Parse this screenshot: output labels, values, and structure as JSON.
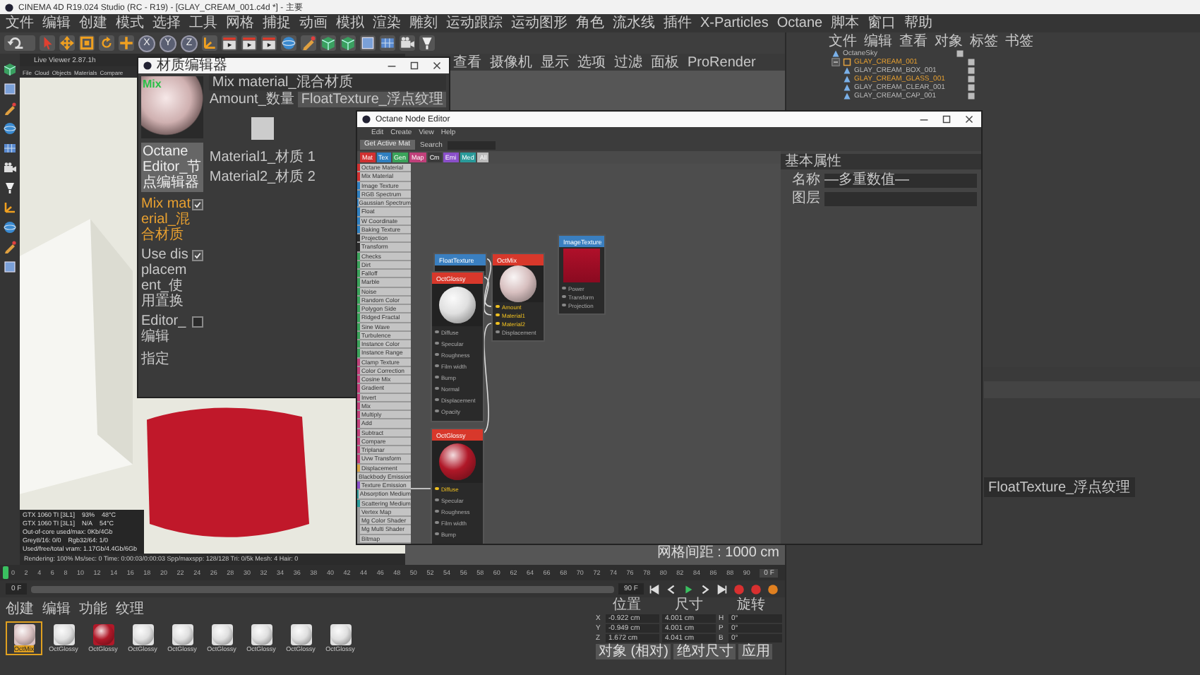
{
  "app": {
    "title": "CINEMA 4D R19.024 Studio (RC - R19) - [GLAY_CREAM_001.c4d *] - 主要",
    "menu": [
      "文件",
      "编辑",
      "创建",
      "模式",
      "选择",
      "工具",
      "网格",
      "捕捉",
      "动画",
      "模拟",
      "渲染",
      "雕刻",
      "运动跟踪",
      "运动图形",
      "角色",
      "流水线",
      "插件",
      "X-Particles",
      "Octane",
      "脚本",
      "窗口",
      "帮助"
    ],
    "axis_buttons": [
      "X",
      "Y",
      "Z"
    ]
  },
  "live_viewer": {
    "title": "Live Viewer 2.87.1h",
    "menu": [
      "File",
      "Cloud",
      "Objects",
      "Materials",
      "Compare"
    ],
    "stats": [
      [
        "GTX 1060 TI [3L1]",
        "93%",
        "48°C"
      ],
      [
        "GTX 1060 TI [3L1]",
        "N/A",
        "54°C"
      ],
      [
        "Out-of-core used/max: 0Kb/4Gb"
      ],
      [
        "Grey8/16: 0/0",
        "Rgb32/64: 1/0"
      ],
      [
        "Used/free/total vram: 1.17Gb/4.4Gb/6Gb"
      ]
    ],
    "status": "Rendering: 100%  Ms/sec: 0  Time: 0:00:03/0:00:03  Spp/maxspp: 128/128  Tri: 0/5k  Mesh: 4  Hair: 0"
  },
  "viewport": {
    "tabs": [
      "查看",
      "摄像机",
      "显示",
      "选项",
      "过滤",
      "面板",
      "ProRender"
    ],
    "grid_info": "网格间距 : 1000 cm"
  },
  "material_editor": {
    "title": "材质编辑器",
    "preview_label": "Mix",
    "heading": "Mix material_混合材质",
    "amount_label": "Amount_数量",
    "amount_texture": "FloatTexture_浮点纹理",
    "channels": [
      {
        "kind": "button",
        "label": "Octane Editor_节点编辑器"
      },
      {
        "kind": "check",
        "label": "Mix material_混合材质",
        "checked": true,
        "selected": true
      },
      {
        "kind": "check",
        "label": "Use displacement_使用置换",
        "checked": true,
        "selected": false
      },
      {
        "kind": "check",
        "label": "Editor_编辑",
        "checked": false,
        "selected": false
      },
      {
        "kind": "plain",
        "label": "指定"
      }
    ],
    "material_slots": [
      "Material1_材质 1",
      "Material2_材质 2"
    ]
  },
  "node_editor": {
    "title": "Octane Node Editor",
    "menu": [
      "Edit",
      "Create",
      "View",
      "Help"
    ],
    "get_button": "Get Active Mat",
    "search_label": "Search",
    "tags": [
      {
        "label": "Mat",
        "color": "#d03030"
      },
      {
        "label": "Tex",
        "color": "#2f7fc0"
      },
      {
        "label": "Gen",
        "color": "#3aa35a"
      },
      {
        "label": "Map",
        "color": "#c0407a"
      },
      {
        "label": "Cm",
        "color": "#3a3a3a"
      },
      {
        "label": "Emi",
        "color": "#8a4fc9"
      },
      {
        "label": "Med",
        "color": "#2a9a9a"
      },
      {
        "label": "All",
        "color": "#bbbbbb"
      }
    ],
    "groups": [
      {
        "color": "#d03030",
        "items": [
          "Octane Material",
          "Mix Material"
        ]
      },
      {
        "color": "#2f7fc0",
        "items": [
          "Image Texture",
          "RGB Spectrum",
          "Gaussian Spectrum",
          "Float",
          "W Coordinate",
          "Baking Texture"
        ]
      },
      {
        "color": "#2a2a2a",
        "items": [
          "Projection",
          "Transform"
        ]
      },
      {
        "color": "#3aa35a",
        "items": [
          "Checks",
          "Dirt",
          "Falloff",
          "Marble",
          "Noise",
          "Random Color",
          "Polygon Side",
          "Ridged Fractal",
          "Sine Wave",
          "Turbulence",
          "Instance Color",
          "Instance Range"
        ]
      },
      {
        "color": "#c0407a",
        "items": [
          "Clamp Texture",
          "Color Correction",
          "Cosine Mix",
          "Gradient",
          "Invert",
          "Mix",
          "Multiply",
          "Add",
          "Subtract",
          "Compare",
          "Triplanar",
          "Uvw Transform"
        ]
      },
      {
        "color": "#d9a441",
        "items": [
          "Displacement"
        ]
      },
      {
        "color": "#8a4fc9",
        "items": [
          "Blackbody Emission",
          "Texture Emission"
        ]
      },
      {
        "color": "#2a9a9a",
        "items": [
          "Absorption Medium",
          "Scattering Medium"
        ]
      },
      {
        "color": "#9a9a9a",
        "items": [
          "Vertex Map",
          "Mg Color Shader",
          "Mg Multi Shader",
          "Bitmap"
        ]
      }
    ],
    "nodes": [
      {
        "kind": "float",
        "title": "FloatTexture"
      },
      {
        "kind": "material",
        "title": "OctGlossy",
        "color": "#e0e0e0",
        "pins": [
          {
            "label": "Diffuse",
            "connected": false
          },
          {
            "label": "Specular",
            "connected": false
          },
          {
            "label": "Roughness",
            "connected": false
          },
          {
            "label": "Film width",
            "connected": false
          },
          {
            "label": "Bump",
            "connected": false
          },
          {
            "label": "Normal",
            "connected": false
          },
          {
            "label": "Displacement",
            "connected": false
          },
          {
            "label": "Opacity",
            "connected": false
          }
        ]
      },
      {
        "kind": "mix",
        "title": "OctMix",
        "color": "#d8c0c0",
        "pins": [
          {
            "label": "Amount",
            "connected": true
          },
          {
            "label": "Material1",
            "connected": true
          },
          {
            "label": "Material2",
            "connected": true
          },
          {
            "label": "Displacement",
            "connected": false
          }
        ]
      },
      {
        "kind": "image",
        "title": "ImageTexture",
        "pins": [
          {
            "label": "Power",
            "connected": false
          },
          {
            "label": "Transform",
            "connected": false
          },
          {
            "label": "Projection",
            "connected": false
          }
        ]
      },
      {
        "kind": "material",
        "title": "OctGlossy",
        "color": "#b01828",
        "pins": [
          {
            "label": "Diffuse",
            "connected": true
          },
          {
            "label": "Specular",
            "connected": false
          },
          {
            "label": "Roughness",
            "connected": false
          },
          {
            "label": "Film width",
            "connected": false
          },
          {
            "label": "Bump",
            "connected": false
          }
        ]
      }
    ],
    "properties": {
      "heading": "基本属性",
      "fields": [
        {
          "label": "名称",
          "value": "—多重数值—"
        },
        {
          "label": "图层"
        }
      ]
    }
  },
  "object_manager": {
    "tabs": [
      "文件",
      "编辑",
      "查看",
      "对象",
      "标签",
      "书签"
    ],
    "items": [
      {
        "label": "OctaneSky",
        "selected": false
      },
      {
        "label": "GLAY_CREAM_001",
        "selected": true,
        "expanded": true,
        "children": [
          {
            "label": "GLAY_CREAM_BOX_001",
            "selected": false
          },
          {
            "label": "GLAY_CREAM_GLASS_001",
            "selected": true
          },
          {
            "label": "GLAY_CREAM_CLEAR_001",
            "selected": false
          },
          {
            "label": "GLAY_CREAM_CAP_001",
            "selected": false
          }
        ]
      }
    ]
  },
  "attributes": {
    "texture_field": "FloatTexture_浮点纹理"
  },
  "timeline": {
    "ticks": [
      "0",
      "2",
      "4",
      "6",
      "8",
      "10",
      "12",
      "14",
      "16",
      "18",
      "20",
      "22",
      "24",
      "26",
      "28",
      "30",
      "32",
      "34",
      "36",
      "38",
      "40",
      "42",
      "44",
      "46",
      "48",
      "50",
      "52",
      "54",
      "56",
      "58",
      "60",
      "62",
      "64",
      "66",
      "68",
      "70",
      "72",
      "74",
      "76",
      "78",
      "80",
      "82",
      "84",
      "86",
      "88",
      "90"
    ],
    "current": "0 F",
    "start": "0 F",
    "end": "90 F"
  },
  "materials": {
    "tabs": [
      "创建",
      "编辑",
      "功能",
      "纹理"
    ],
    "items": [
      {
        "label": "OctMix",
        "color": "#d8c0c0",
        "selected": true
      },
      {
        "label": "OctGlossy",
        "color": "#e0e0e0",
        "selected": false
      },
      {
        "label": "OctGlossy",
        "color": "#b01828",
        "selected": false
      },
      {
        "label": "OctGlossy",
        "color": "#e0e0e0",
        "selected": false
      },
      {
        "label": "OctGlossy",
        "color": "#e0e0e0",
        "selected": false
      },
      {
        "label": "OctGlossy",
        "color": "#e0e0e0",
        "selected": false
      },
      {
        "label": "OctGlossy",
        "color": "#e0e0e0",
        "selected": false
      },
      {
        "label": "OctGlossy",
        "color": "#e0e0e0",
        "selected": false
      },
      {
        "label": "OctGlossy",
        "color": "#e0e0e0",
        "selected": false
      }
    ]
  },
  "coordinates": {
    "headers": [
      "位置",
      "尺寸",
      "旋转"
    ],
    "rows": [
      {
        "axis": "X",
        "position": "-0.922 cm",
        "size": "4.001 cm",
        "rot_axis": "H",
        "rotation": "0°"
      },
      {
        "axis": "Y",
        "position": "-0.949 cm",
        "size": "4.001 cm",
        "rot_axis": "P",
        "rotation": "0°"
      },
      {
        "axis": "Z",
        "position": "1.672 cm",
        "size": "4.041 cm",
        "rot_axis": "B",
        "rotation": "0°"
      }
    ],
    "buttons": [
      "对象 (相对)",
      "绝对尺寸",
      "应用"
    ]
  }
}
